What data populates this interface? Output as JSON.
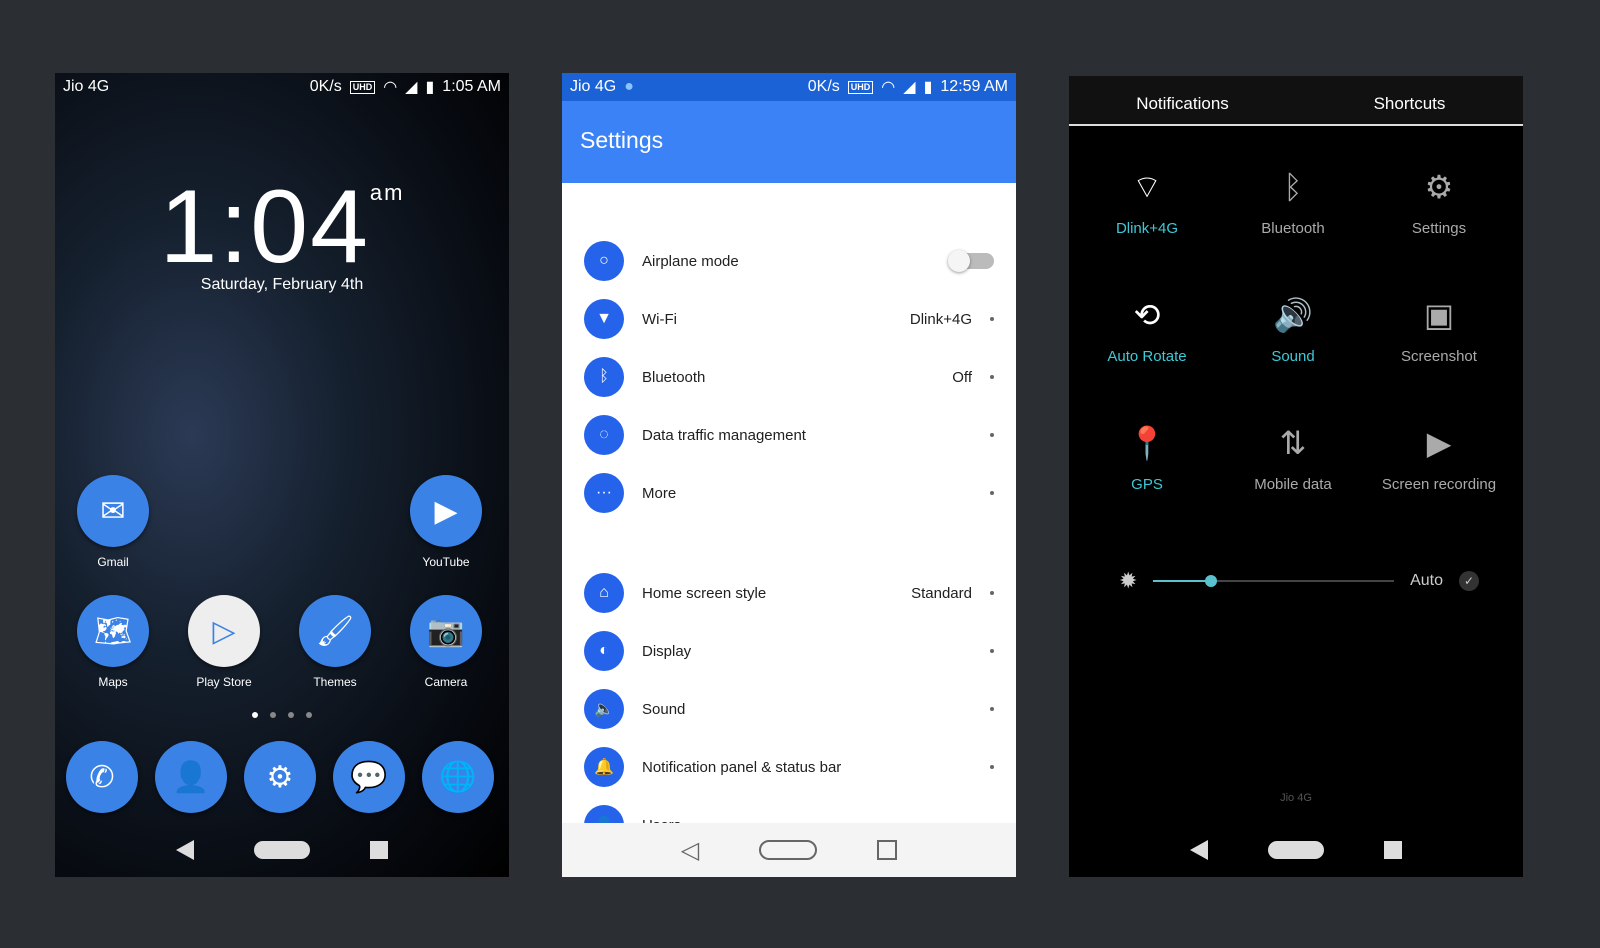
{
  "home": {
    "status": {
      "carrier": "Jio 4G",
      "speed": "0K/s",
      "uhd": "UHD",
      "time": "1:05 AM"
    },
    "clock": "1:04",
    "ampm": "am",
    "date": "Saturday, February 4th",
    "apps": [
      {
        "label": "Gmail",
        "icon": "mail-icon"
      },
      {
        "label": "YouTube",
        "icon": "play-icon"
      },
      {
        "label": "Maps",
        "icon": "map-icon"
      },
      {
        "label": "Play Store",
        "icon": "play-store-icon"
      },
      {
        "label": "Themes",
        "icon": "paint-roller-icon"
      },
      {
        "label": "Camera",
        "icon": "camera-icon"
      }
    ],
    "dock": [
      "phone-icon",
      "contacts-icon",
      "settings-icon",
      "messages-icon",
      "browser-icon"
    ],
    "pages": 4,
    "current_page": 1
  },
  "settings": {
    "status": {
      "carrier": "Jio 4G",
      "speed": "0K/s",
      "uhd": "UHD",
      "time": "12:59 AM"
    },
    "title": "Settings",
    "items": [
      {
        "label": "Airplane mode",
        "value": "",
        "toggle": false
      },
      {
        "label": "Wi-Fi",
        "value": "Dlink+4G"
      },
      {
        "label": "Bluetooth",
        "value": "Off"
      },
      {
        "label": "Data traffic management",
        "value": ""
      },
      {
        "label": "More",
        "value": ""
      },
      {
        "label": "Home screen style",
        "value": "Standard"
      },
      {
        "label": "Display",
        "value": ""
      },
      {
        "label": "Sound",
        "value": ""
      },
      {
        "label": "Notification panel & status bar",
        "value": ""
      },
      {
        "label": "Users",
        "value": ""
      }
    ],
    "accent": "#3b82f6"
  },
  "quick": {
    "tabs": [
      "Notifications",
      "Shortcuts"
    ],
    "tiles": [
      {
        "label": "Dlink+4G",
        "icon": "wifi-icon",
        "on": true
      },
      {
        "label": "Bluetooth",
        "icon": "bluetooth-icon",
        "on": false
      },
      {
        "label": "Settings",
        "icon": "gear-icon",
        "on": false
      },
      {
        "label": "Auto Rotate",
        "icon": "rotate-icon",
        "on": true
      },
      {
        "label": "Sound",
        "icon": "speaker-icon",
        "on": true
      },
      {
        "label": "Screenshot",
        "icon": "screenshot-icon",
        "on": false
      },
      {
        "label": "GPS",
        "icon": "location-icon",
        "on": true
      },
      {
        "label": "Mobile data",
        "icon": "data-arrows-icon",
        "on": false
      },
      {
        "label": "Screen recording",
        "icon": "video-icon",
        "on": false
      }
    ],
    "brightness_percent": 24,
    "auto_label": "Auto",
    "auto_checked": true,
    "carrier": "Jio 4G",
    "accent": "#3ec9d6"
  }
}
